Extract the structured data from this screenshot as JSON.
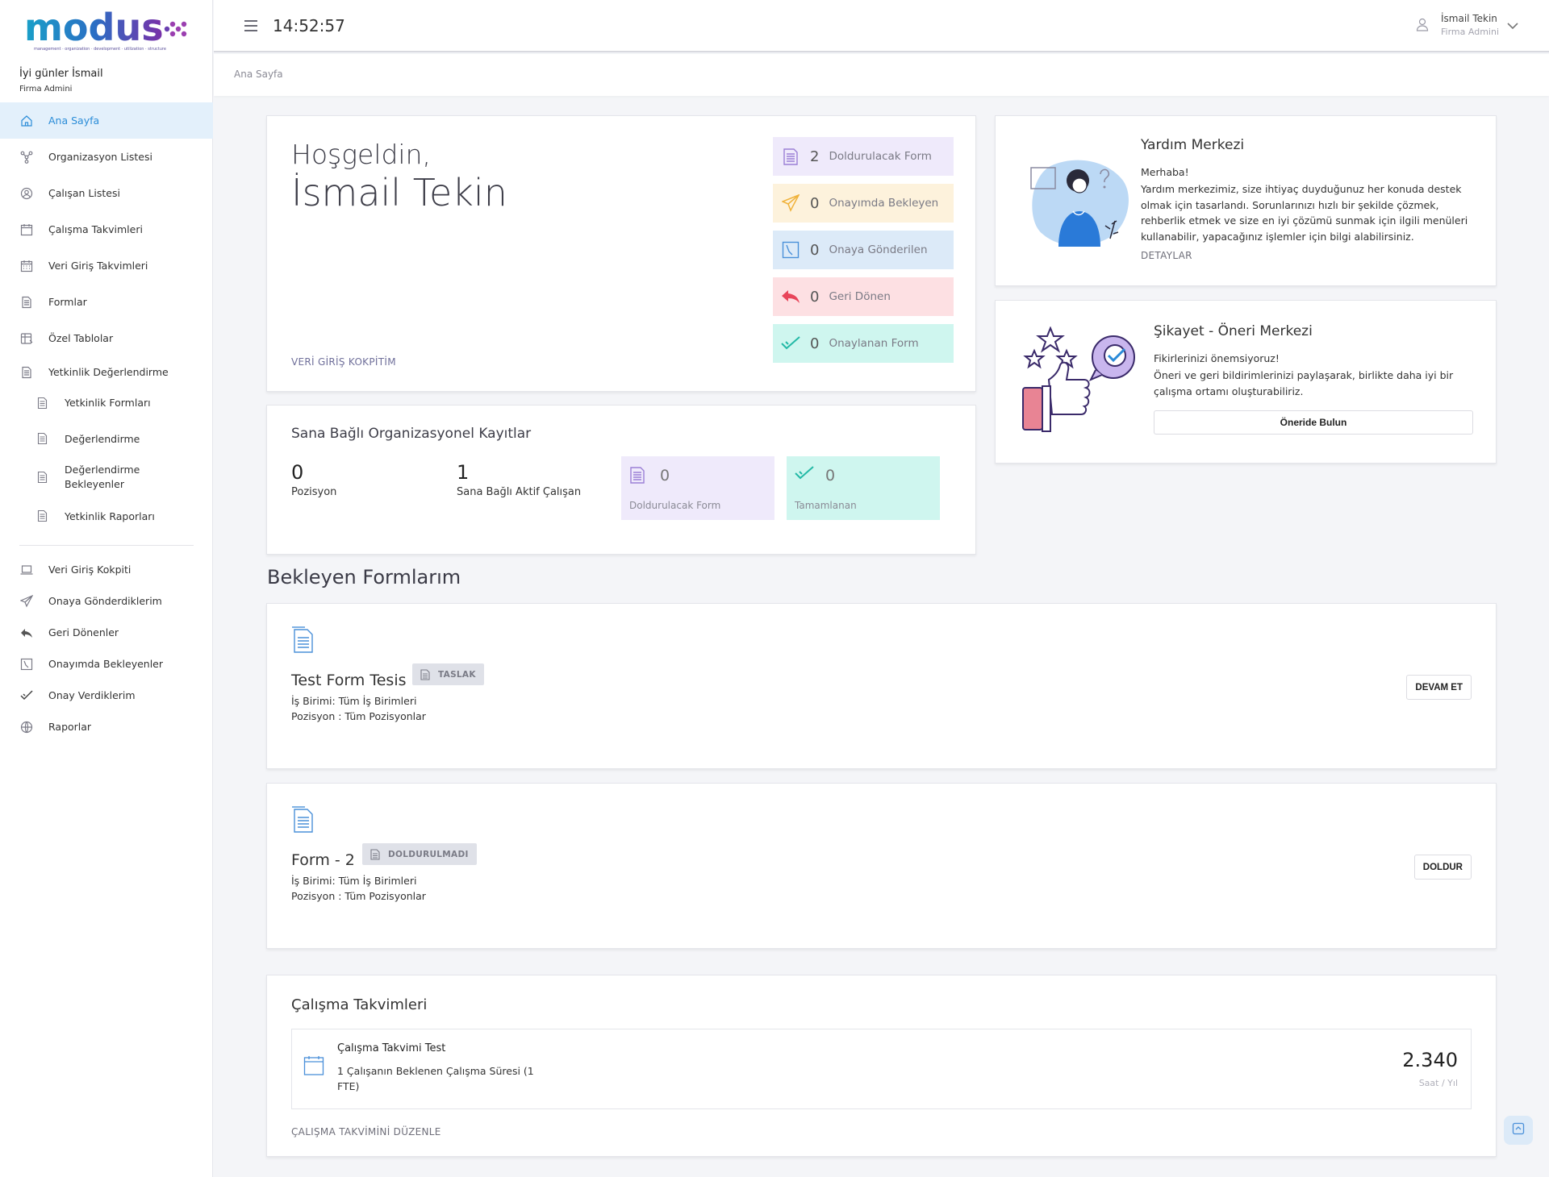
{
  "brand": {
    "logo_text": "modus",
    "tagline": "management · organization · development · utilization · structure"
  },
  "sidebar": {
    "greeting": "İyi günler İsmail",
    "role": "Firma Admini",
    "items": [
      {
        "label": "Ana Sayfa",
        "icon": "home-icon"
      },
      {
        "label": "Organizasyon Listesi",
        "icon": "org-chart-icon"
      },
      {
        "label": "Çalışan Listesi",
        "icon": "user-circle-icon"
      },
      {
        "label": "Çalışma Takvimleri",
        "icon": "calendar-icon"
      },
      {
        "label": "Veri Giriş Takvimleri",
        "icon": "calendar-grid-icon"
      },
      {
        "label": "Formlar",
        "icon": "document-icon"
      },
      {
        "label": "Özel Tablolar",
        "icon": "table-icon"
      },
      {
        "label": "Yetkinlik Değerlendirme",
        "icon": "document-icon"
      },
      {
        "label": "Yetkinlik Formları",
        "icon": "document-icon"
      },
      {
        "label": "Değerlendirme",
        "icon": "document-icon"
      },
      {
        "label": "Değerlendirme Bekleyenler",
        "icon": "document-icon"
      },
      {
        "label": "Yetkinlik Raporları",
        "icon": "document-icon"
      },
      {
        "label": "Veri Giriş Kokpiti",
        "icon": "laptop-icon"
      },
      {
        "label": "Onaya Gönderdiklerim",
        "icon": "paper-plane-icon"
      },
      {
        "label": "Geri Dönenler",
        "icon": "reply-icon"
      },
      {
        "label": "Onayımda Bekleyenler",
        "icon": "clock-page-icon"
      },
      {
        "label": "Onay Verdiklerim",
        "icon": "double-check-icon"
      },
      {
        "label": "Raporlar",
        "icon": "globe-icon"
      }
    ]
  },
  "topbar": {
    "time": "14:52:57",
    "user_name": "İsmail Tekin",
    "user_role": "Firma Admini"
  },
  "breadcrumb": "Ana Sayfa",
  "welcome": {
    "line1": "Hoşgeldin,",
    "line2": "İsmail Tekin",
    "link": "VERİ GİRİŞ KOKPİTİM",
    "stats": [
      {
        "count": "2",
        "label": "Doldurulacak Form",
        "bg": "#efeafb",
        "color": "#9b7fd6",
        "icon": "form-icon"
      },
      {
        "count": "0",
        "label": "Onayımda Bekleyen",
        "bg": "#fdf2dc",
        "color": "#f0b23a",
        "icon": "paper-plane-icon"
      },
      {
        "count": "0",
        "label": "Onaya Gönderilen",
        "bg": "#dceaf8",
        "color": "#4a90d9",
        "icon": "clock-page-icon"
      },
      {
        "count": "0",
        "label": "Geri Dönen",
        "bg": "#fde0e3",
        "color": "#e8455a",
        "icon": "reply-icon"
      },
      {
        "count": "0",
        "label": "Onaylanan Form",
        "bg": "#cff6ef",
        "color": "#23b9a6",
        "icon": "double-check-icon"
      }
    ]
  },
  "org": {
    "title": "Sana Bağlı Organizasyonel Kayıtlar",
    "position_count": "0",
    "position_label": "Pozisyon",
    "employee_count": "1",
    "employee_label": "Sana Bağlı Aktif Çalışan",
    "tiles": [
      {
        "count": "0",
        "label": "Doldurulacak Form",
        "bg": "#efeafb",
        "icon": "form-icon"
      },
      {
        "count": "0",
        "label": "Tamamlanan",
        "bg": "#cff6ef",
        "icon": "double-check-icon"
      }
    ]
  },
  "help": {
    "title": "Yardım Merkezi",
    "hello": "Merhaba!",
    "body": "Yardım merkezimiz, size ihtiyaç duyduğunuz her konuda destek olmak için tasarlandı. Sorunlarınızı hızlı bir şekilde çözmek, rehberlik etmek ve size en iyi çözümü sunmak için ilgili menüleri kullanabilir, yapacağınız işlemler için bilgi alabilirsiniz.",
    "link": "DETAYLAR"
  },
  "complaint": {
    "title": "Şikayet - Öneri Merkezi",
    "line1": "Fikirlerinizi önemsiyoruz!",
    "body": "Öneri ve geri bildirimlerinizi paylaşarak, birlikte daha iyi bir çalışma ortamı oluşturabiliriz.",
    "button": "Öneride Bulun"
  },
  "pending": {
    "title": "Bekleyen Formlarım",
    "forms": [
      {
        "name": "Test Form Tesis",
        "badge": "TASLAK",
        "unit": "İş Birimi: Tüm İş Birimleri",
        "position": "Pozisyon : Tüm Pozisyonlar",
        "action": "DEVAM ET"
      },
      {
        "name": "Form - 2",
        "badge": "DOLDURULMADI",
        "unit": "İş Birimi: Tüm İş Birimleri",
        "position": "Pozisyon : Tüm Pozisyonlar",
        "action": "DOLDUR"
      }
    ]
  },
  "calendars": {
    "title": "Çalışma Takvimleri",
    "item_name": "Çalışma Takvimi Test",
    "item_desc": "1 Çalışanın Beklenen Çalışma Süresi (1 FTE)",
    "hours": "2.340",
    "unit": "Saat / Yıl",
    "edit_link": "ÇALIŞMA TAKVİMİNİ DÜZENLE"
  }
}
